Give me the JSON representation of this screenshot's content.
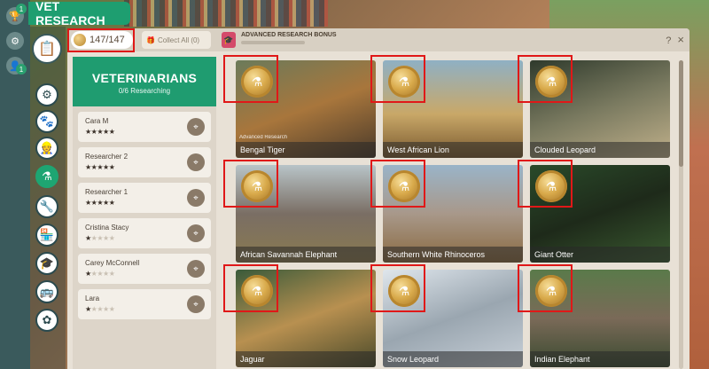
{
  "app": {
    "title": "VET RESEARCH"
  },
  "rail": {
    "badge_top": "1",
    "badge_bottom": "1"
  },
  "topbar": {
    "currency": "147/147",
    "collect_label": "Collect All (0)",
    "bonus_label": "ADVANCED RESEARCH BONUS",
    "help": "?",
    "close": "×"
  },
  "vets": {
    "title": "VETERINARIANS",
    "subtitle": "0/6 Researching",
    "list": [
      {
        "name": "Cara M",
        "stars": 5
      },
      {
        "name": "Researcher 2",
        "stars": 5
      },
      {
        "name": "Researcher 1",
        "stars": 5
      },
      {
        "name": "Cristina Stacy",
        "stars": 1
      },
      {
        "name": "Carey McConnell",
        "stars": 1
      },
      {
        "name": "Lara",
        "stars": 1
      }
    ]
  },
  "research": [
    {
      "name": "Bengal Tiger",
      "sub": "Advanced Research",
      "bg": "linear-gradient(160deg,#6b7a5a,#a8763c 50%,#4a3a2a)"
    },
    {
      "name": "West African Lion",
      "sub": "",
      "bg": "linear-gradient(180deg,#8fb0c4,#c9a868 55%,#7a5a30)"
    },
    {
      "name": "Clouded Leopard",
      "sub": "",
      "bg": "linear-gradient(160deg,#2f3a2c,#7a7a60 50%,#c0b08a)"
    },
    {
      "name": "African Savannah Elephant",
      "sub": "",
      "bg": "linear-gradient(180deg,#b8c4c8,#7a6e64 50%,#8a7a50)"
    },
    {
      "name": "Southern White Rhinoceros",
      "sub": "",
      "bg": "linear-gradient(180deg,#9ab4c8,#a8988a 50%,#8a6a40)"
    },
    {
      "name": "Giant Otter",
      "sub": "",
      "bg": "linear-gradient(160deg,#2a4a2a,#1e2a1a 50%,#3a5a30)"
    },
    {
      "name": "Jaguar",
      "sub": "",
      "bg": "linear-gradient(160deg,#3a5a3a,#b89050 50%,#4a4a2a)"
    },
    {
      "name": "Snow Leopard",
      "sub": "",
      "bg": "linear-gradient(160deg,#dfe6ec,#9aa6b0 50%,#c8d0d8)"
    },
    {
      "name": "Indian Elephant",
      "sub": "",
      "bg": "linear-gradient(180deg,#5a7a4a,#7a6a58 50%,#3a4a30)"
    }
  ]
}
